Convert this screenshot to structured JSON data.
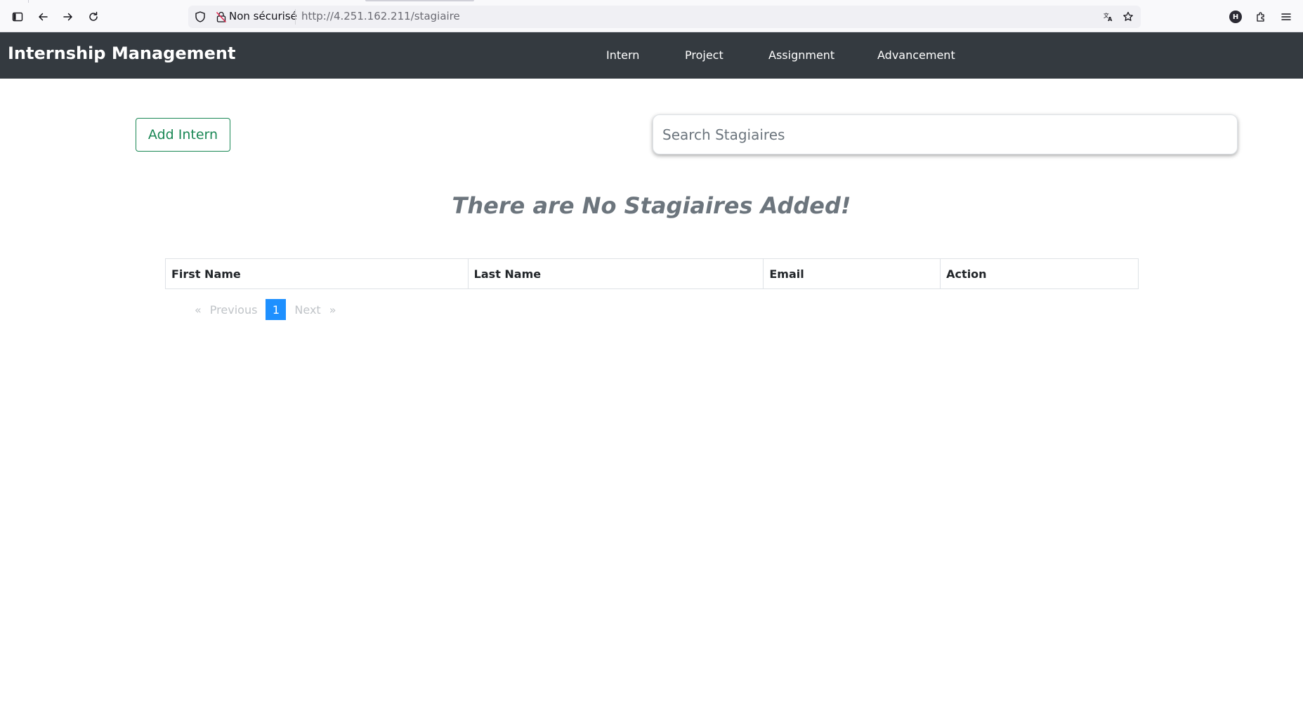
{
  "browser": {
    "security_label": "Non sécurisé",
    "url": "http://4.251.162.211/stagiaire",
    "profile_initial": "H"
  },
  "navbar": {
    "brand": "Internship Management",
    "links": [
      "Intern",
      "Project",
      "Assignment",
      "Advancement"
    ]
  },
  "main": {
    "add_button_label": "Add Intern",
    "search_placeholder": "Search Stagiaires",
    "empty_message": "There are No Stagiaires Added!",
    "table_headers": [
      "First Name",
      "Last Name",
      "Email",
      "Action"
    ]
  },
  "pagination": {
    "prev_arrow": "«",
    "prev_label": "Previous",
    "current_page": "1",
    "next_label": "Next",
    "next_arrow": "»"
  },
  "colors": {
    "navbar_bg": "#343a40",
    "success": "#198754",
    "muted": "#6c757d",
    "active_page": "#1e90ff"
  }
}
